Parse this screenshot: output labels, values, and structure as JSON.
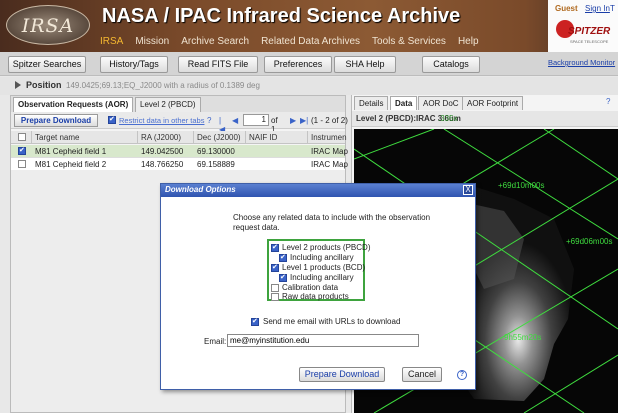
{
  "header": {
    "logo_text": "IRSA",
    "title": "NASA / IPAC Infrared Science Archive",
    "nav": [
      "IRSA",
      "Mission",
      "Archive Search",
      "Related Data Archives",
      "Tools & Services",
      "Help"
    ],
    "guest_label": "Guest",
    "signin_label": "Sign In",
    "partial_link": "T",
    "spitzer_logo": "SPITZER",
    "spitzer_sub": "SPACE TELESCOPE"
  },
  "toolbar": {
    "buttons": [
      "Spitzer Searches",
      "History/Tags",
      "Read FITS File",
      "Preferences",
      "SHA Help",
      "Catalogs"
    ],
    "background_monitor": "Background Monitor"
  },
  "position": {
    "label": "Position",
    "value": "149.0425;69.13;EQ_J2000 with a radius of 0.1389 deg"
  },
  "left_panel": {
    "tabs": [
      "Observation Requests (AOR)",
      "Level 2 (PBCD)"
    ],
    "prepare_download": "Prepare Download",
    "restrict_label": "Restrict data in other tabs",
    "page_value": "1",
    "page_of": "of 1",
    "page_count": "(1 - 2 of 2)",
    "columns": [
      "Target name",
      "RA (J2000)",
      "Dec (J2000)",
      "NAIF ID",
      "Instrumen"
    ],
    "rows": [
      {
        "target": "M81 Cepheid field 1",
        "ra": "149.042500",
        "dec": "69.130000",
        "naif": "",
        "instrument": "IRAC Map",
        "checked": true
      },
      {
        "target": "M81 Cepheid field 2",
        "ra": "148.766250",
        "dec": "69.158889",
        "naif": "",
        "instrument": "IRAC Map",
        "checked": false
      }
    ]
  },
  "right_panel": {
    "tabs": [
      "Details",
      "Data",
      "AOR DoC",
      "AOR Footprint"
    ],
    "help": "?",
    "image_label": "Level 2 (PBCD):IRAC 3.6um",
    "zoom": ".335x",
    "grid_labels": [
      "+69d10m00s",
      "+69d06m00s",
      "9h55m20s"
    ]
  },
  "dialog": {
    "title": "Download Options",
    "close": "X",
    "intro": "Choose any related data to include with the observation request data.",
    "options": [
      {
        "label": "Level 2 products (PBCD)",
        "checked": true
      },
      {
        "label": "Including ancillary",
        "checked": true
      },
      {
        "label": "Level 1 products (BCD)",
        "checked": true
      },
      {
        "label": "Including ancillary",
        "checked": true
      },
      {
        "label": "Calibration data",
        "checked": false
      },
      {
        "label": "Raw data products",
        "checked": false
      }
    ],
    "email_checkbox_label": "Send me email with URLs to download",
    "email_label": "Email:",
    "email_value": "me@myinstitution.edu",
    "prepare_button": "Prepare Download",
    "cancel_button": "Cancel",
    "help": "?"
  },
  "colors": {
    "accent": "#2f54b0",
    "grid_green": "#3fdc3f",
    "selected_row": "#d8e8cc",
    "nav_active": "#f5b830"
  }
}
